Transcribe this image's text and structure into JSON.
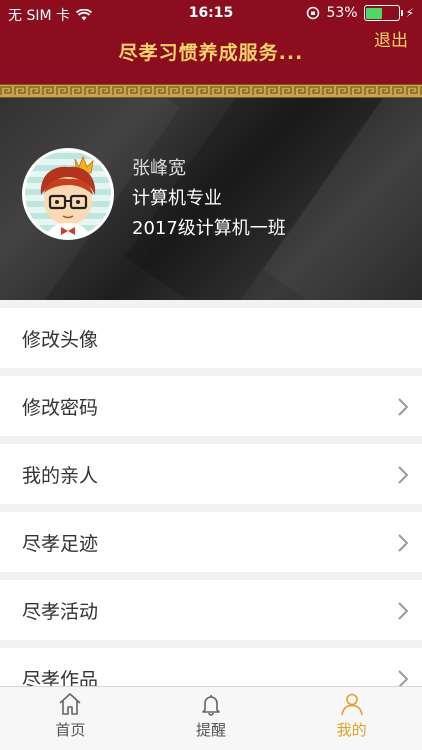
{
  "status_bar": {
    "carrier": "无 SIM 卡",
    "time": "16:15",
    "battery_percent": "53%",
    "battery_level": 0.53,
    "icons": [
      "wifi-icon",
      "rotation-lock-icon",
      "battery-icon",
      "charging-icon"
    ]
  },
  "header": {
    "title": "尽孝习惯养成服务...",
    "logout_label": "退出"
  },
  "profile": {
    "name": "张峰宽",
    "major": "计算机专业",
    "class": "2017级计算机一班"
  },
  "menu": {
    "items": [
      {
        "label": "修改头像",
        "has_chevron": false
      },
      {
        "label": "修改密码",
        "has_chevron": true
      },
      {
        "label": "我的亲人",
        "has_chevron": true
      },
      {
        "label": "尽孝足迹",
        "has_chevron": true
      },
      {
        "label": "尽孝活动",
        "has_chevron": true
      },
      {
        "label": "尽孝作品",
        "has_chevron": true
      }
    ]
  },
  "tabbar": {
    "tabs": [
      {
        "label": "首页",
        "icon": "home-icon",
        "active": false
      },
      {
        "label": "提醒",
        "icon": "bell-icon",
        "active": false
      },
      {
        "label": "我的",
        "icon": "person-icon",
        "active": true
      }
    ]
  },
  "colors": {
    "header_bg": "#8c0d1e",
    "title_gold": "#f7d36b",
    "tab_active": "#e2a02a"
  }
}
